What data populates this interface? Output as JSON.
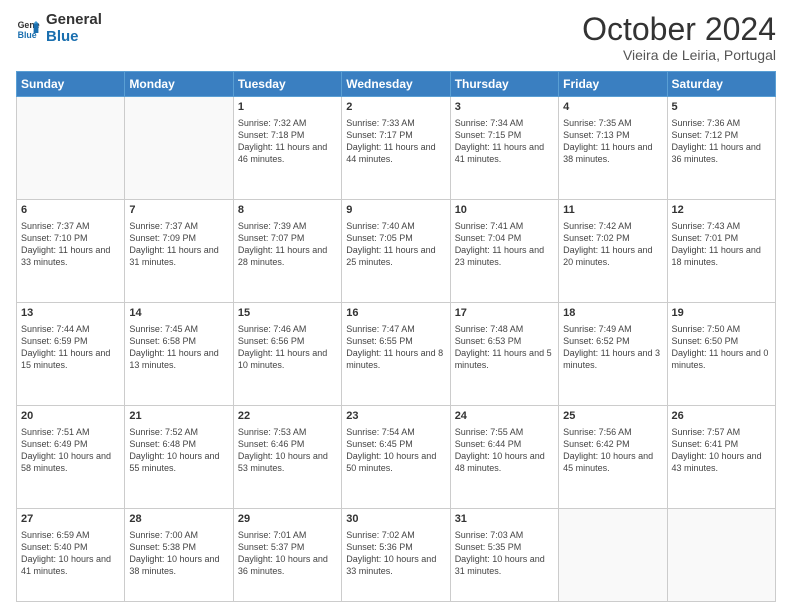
{
  "header": {
    "logo_line1": "General",
    "logo_line2": "Blue",
    "month": "October 2024",
    "location": "Vieira de Leiria, Portugal"
  },
  "weekdays": [
    "Sunday",
    "Monday",
    "Tuesday",
    "Wednesday",
    "Thursday",
    "Friday",
    "Saturday"
  ],
  "weeks": [
    [
      {
        "day": "",
        "sunrise": "",
        "sunset": "",
        "daylight": ""
      },
      {
        "day": "",
        "sunrise": "",
        "sunset": "",
        "daylight": ""
      },
      {
        "day": "1",
        "sunrise": "Sunrise: 7:32 AM",
        "sunset": "Sunset: 7:18 PM",
        "daylight": "Daylight: 11 hours and 46 minutes."
      },
      {
        "day": "2",
        "sunrise": "Sunrise: 7:33 AM",
        "sunset": "Sunset: 7:17 PM",
        "daylight": "Daylight: 11 hours and 44 minutes."
      },
      {
        "day": "3",
        "sunrise": "Sunrise: 7:34 AM",
        "sunset": "Sunset: 7:15 PM",
        "daylight": "Daylight: 11 hours and 41 minutes."
      },
      {
        "day": "4",
        "sunrise": "Sunrise: 7:35 AM",
        "sunset": "Sunset: 7:13 PM",
        "daylight": "Daylight: 11 hours and 38 minutes."
      },
      {
        "day": "5",
        "sunrise": "Sunrise: 7:36 AM",
        "sunset": "Sunset: 7:12 PM",
        "daylight": "Daylight: 11 hours and 36 minutes."
      }
    ],
    [
      {
        "day": "6",
        "sunrise": "Sunrise: 7:37 AM",
        "sunset": "Sunset: 7:10 PM",
        "daylight": "Daylight: 11 hours and 33 minutes."
      },
      {
        "day": "7",
        "sunrise": "Sunrise: 7:37 AM",
        "sunset": "Sunset: 7:09 PM",
        "daylight": "Daylight: 11 hours and 31 minutes."
      },
      {
        "day": "8",
        "sunrise": "Sunrise: 7:39 AM",
        "sunset": "Sunset: 7:07 PM",
        "daylight": "Daylight: 11 hours and 28 minutes."
      },
      {
        "day": "9",
        "sunrise": "Sunrise: 7:40 AM",
        "sunset": "Sunset: 7:05 PM",
        "daylight": "Daylight: 11 hours and 25 minutes."
      },
      {
        "day": "10",
        "sunrise": "Sunrise: 7:41 AM",
        "sunset": "Sunset: 7:04 PM",
        "daylight": "Daylight: 11 hours and 23 minutes."
      },
      {
        "day": "11",
        "sunrise": "Sunrise: 7:42 AM",
        "sunset": "Sunset: 7:02 PM",
        "daylight": "Daylight: 11 hours and 20 minutes."
      },
      {
        "day": "12",
        "sunrise": "Sunrise: 7:43 AM",
        "sunset": "Sunset: 7:01 PM",
        "daylight": "Daylight: 11 hours and 18 minutes."
      }
    ],
    [
      {
        "day": "13",
        "sunrise": "Sunrise: 7:44 AM",
        "sunset": "Sunset: 6:59 PM",
        "daylight": "Daylight: 11 hours and 15 minutes."
      },
      {
        "day": "14",
        "sunrise": "Sunrise: 7:45 AM",
        "sunset": "Sunset: 6:58 PM",
        "daylight": "Daylight: 11 hours and 13 minutes."
      },
      {
        "day": "15",
        "sunrise": "Sunrise: 7:46 AM",
        "sunset": "Sunset: 6:56 PM",
        "daylight": "Daylight: 11 hours and 10 minutes."
      },
      {
        "day": "16",
        "sunrise": "Sunrise: 7:47 AM",
        "sunset": "Sunset: 6:55 PM",
        "daylight": "Daylight: 11 hours and 8 minutes."
      },
      {
        "day": "17",
        "sunrise": "Sunrise: 7:48 AM",
        "sunset": "Sunset: 6:53 PM",
        "daylight": "Daylight: 11 hours and 5 minutes."
      },
      {
        "day": "18",
        "sunrise": "Sunrise: 7:49 AM",
        "sunset": "Sunset: 6:52 PM",
        "daylight": "Daylight: 11 hours and 3 minutes."
      },
      {
        "day": "19",
        "sunrise": "Sunrise: 7:50 AM",
        "sunset": "Sunset: 6:50 PM",
        "daylight": "Daylight: 11 hours and 0 minutes."
      }
    ],
    [
      {
        "day": "20",
        "sunrise": "Sunrise: 7:51 AM",
        "sunset": "Sunset: 6:49 PM",
        "daylight": "Daylight: 10 hours and 58 minutes."
      },
      {
        "day": "21",
        "sunrise": "Sunrise: 7:52 AM",
        "sunset": "Sunset: 6:48 PM",
        "daylight": "Daylight: 10 hours and 55 minutes."
      },
      {
        "day": "22",
        "sunrise": "Sunrise: 7:53 AM",
        "sunset": "Sunset: 6:46 PM",
        "daylight": "Daylight: 10 hours and 53 minutes."
      },
      {
        "day": "23",
        "sunrise": "Sunrise: 7:54 AM",
        "sunset": "Sunset: 6:45 PM",
        "daylight": "Daylight: 10 hours and 50 minutes."
      },
      {
        "day": "24",
        "sunrise": "Sunrise: 7:55 AM",
        "sunset": "Sunset: 6:44 PM",
        "daylight": "Daylight: 10 hours and 48 minutes."
      },
      {
        "day": "25",
        "sunrise": "Sunrise: 7:56 AM",
        "sunset": "Sunset: 6:42 PM",
        "daylight": "Daylight: 10 hours and 45 minutes."
      },
      {
        "day": "26",
        "sunrise": "Sunrise: 7:57 AM",
        "sunset": "Sunset: 6:41 PM",
        "daylight": "Daylight: 10 hours and 43 minutes."
      }
    ],
    [
      {
        "day": "27",
        "sunrise": "Sunrise: 6:59 AM",
        "sunset": "Sunset: 5:40 PM",
        "daylight": "Daylight: 10 hours and 41 minutes."
      },
      {
        "day": "28",
        "sunrise": "Sunrise: 7:00 AM",
        "sunset": "Sunset: 5:38 PM",
        "daylight": "Daylight: 10 hours and 38 minutes."
      },
      {
        "day": "29",
        "sunrise": "Sunrise: 7:01 AM",
        "sunset": "Sunset: 5:37 PM",
        "daylight": "Daylight: 10 hours and 36 minutes."
      },
      {
        "day": "30",
        "sunrise": "Sunrise: 7:02 AM",
        "sunset": "Sunset: 5:36 PM",
        "daylight": "Daylight: 10 hours and 33 minutes."
      },
      {
        "day": "31",
        "sunrise": "Sunrise: 7:03 AM",
        "sunset": "Sunset: 5:35 PM",
        "daylight": "Daylight: 10 hours and 31 minutes."
      },
      {
        "day": "",
        "sunrise": "",
        "sunset": "",
        "daylight": ""
      },
      {
        "day": "",
        "sunrise": "",
        "sunset": "",
        "daylight": ""
      }
    ]
  ]
}
